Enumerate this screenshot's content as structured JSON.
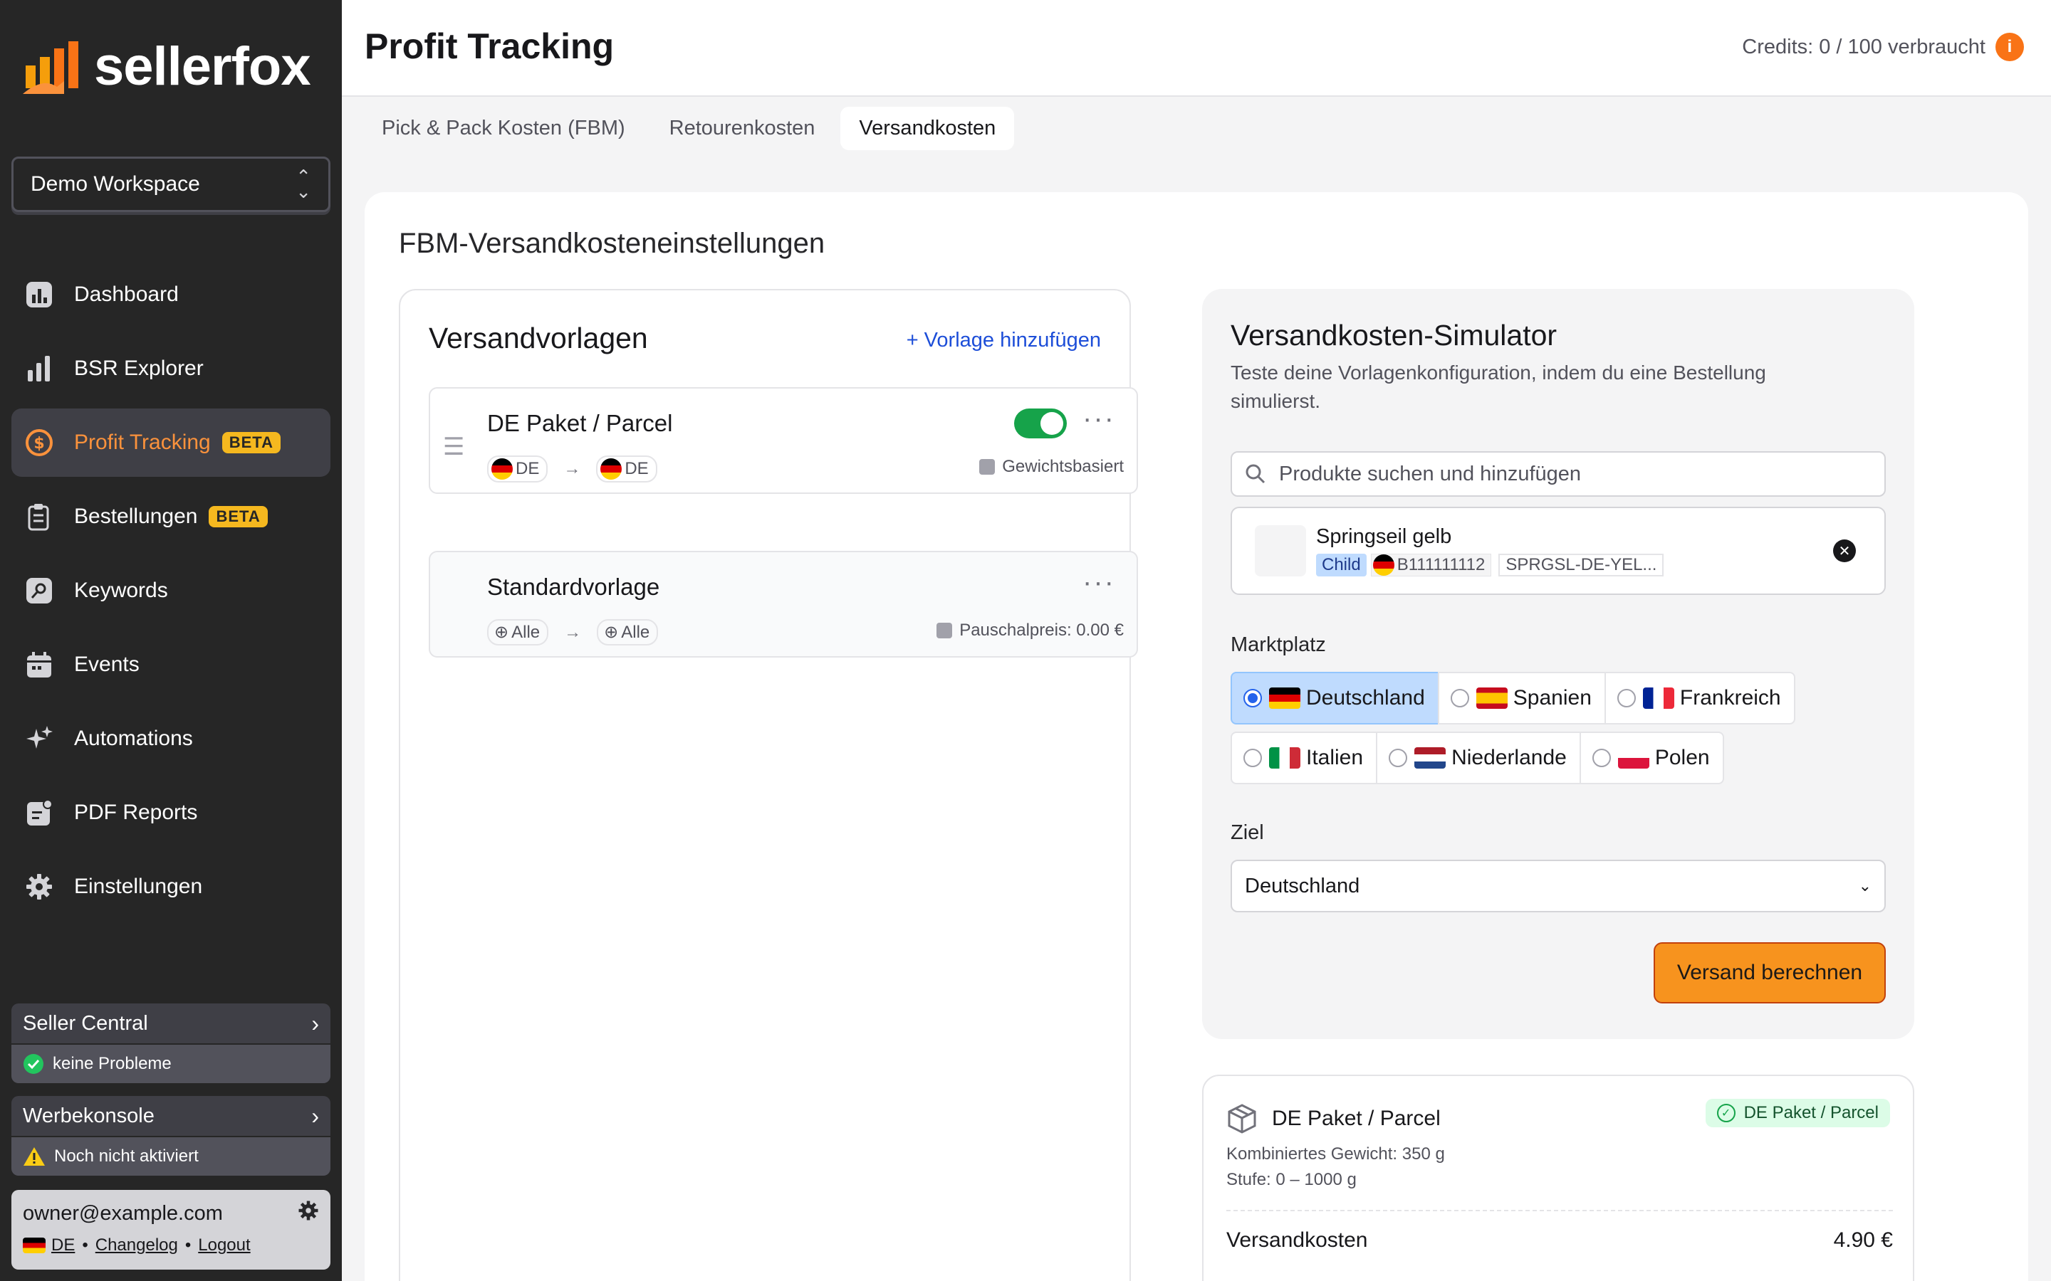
{
  "brand": {
    "name": "sellerfox",
    "accent": "#f97316"
  },
  "workspace": {
    "name": "Demo Workspace"
  },
  "nav": [
    {
      "label": "Dashboard",
      "icon": "dashboard-icon",
      "badge": ""
    },
    {
      "label": "BSR Explorer",
      "icon": "bar-chart-icon",
      "badge": ""
    },
    {
      "label": "Profit Tracking",
      "icon": "dollar-icon",
      "badge": "BETA",
      "active": true
    },
    {
      "label": "Bestellungen",
      "icon": "clipboard-icon",
      "badge": "BETA"
    },
    {
      "label": "Keywords",
      "icon": "key-icon",
      "badge": ""
    },
    {
      "label": "Events",
      "icon": "calendar-icon",
      "badge": ""
    },
    {
      "label": "Automations",
      "icon": "sparkle-icon",
      "badge": ""
    },
    {
      "label": "PDF Reports",
      "icon": "report-icon",
      "badge": ""
    },
    {
      "label": "Einstellungen",
      "icon": "gear-icon",
      "badge": ""
    }
  ],
  "seller_central": {
    "title": "Seller Central",
    "status": "keine Probleme"
  },
  "werbekonsole": {
    "title": "Werbekonsole",
    "status": "Noch nicht aktiviert"
  },
  "user": {
    "email": "owner@example.com",
    "lang": "DE",
    "changelog": "Changelog",
    "logout": "Logout"
  },
  "header": {
    "title": "Profit Tracking",
    "credits": "Credits: 0 / 100 verbraucht",
    "info": "i"
  },
  "tabs": [
    {
      "label": "Pick & Pack Kosten (FBM)"
    },
    {
      "label": "Retourenkosten"
    },
    {
      "label": "Versandkosten",
      "active": true
    }
  ],
  "main": {
    "title": "FBM-Versandkosteneinstellungen"
  },
  "templates": {
    "title": "Versandvorlagen",
    "add_label": "+ Vorlage hinzufügen",
    "items": [
      {
        "name": "DE Paket / Parcel",
        "from": "DE",
        "to": "DE",
        "type": "Gewichtsbasiert",
        "enabled": true
      },
      {
        "name": "Standardvorlage",
        "from": "Alle",
        "to": "Alle",
        "type": "Pauschalpreis: 0.00 €"
      }
    ]
  },
  "simulator": {
    "title": "Versandkosten-Simulator",
    "description": "Teste deine Vorlagenkonfiguration, indem du eine Bestellung simulierst.",
    "search_placeholder": "Produkte suchen und hinzufügen",
    "product": {
      "name": "Springseil gelb",
      "badge": "Child",
      "asin": "B111111112",
      "sku": "SPRGSL-DE-YEL..."
    },
    "marketplace_label": "Marktplatz",
    "marketplaces": [
      "Deutschland",
      "Spanien",
      "Frankreich",
      "Italien",
      "Niederlande",
      "Polen"
    ],
    "selected_marketplace": "Deutschland",
    "target_label": "Ziel",
    "target_value": "Deutschland",
    "button": "Versand berechnen"
  },
  "result": {
    "title": "DE Paket / Parcel",
    "badge": "DE Paket / Parcel",
    "weight": "Kombiniertes Gewicht: 350 g",
    "tier": "Stufe: 0 – 1000 g",
    "cost_label": "Versandkosten",
    "cost_value": "4.90 €"
  }
}
